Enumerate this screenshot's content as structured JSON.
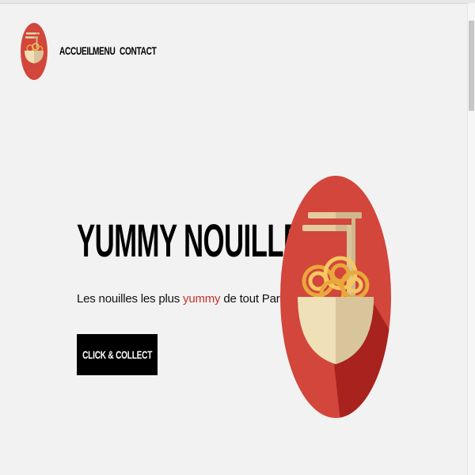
{
  "nav": {
    "items": [
      {
        "label": "ACCUEIL"
      },
      {
        "label": "MENU"
      },
      {
        "label": "CONTACT"
      }
    ]
  },
  "hero": {
    "title": "YUMMY NOUILLES",
    "tagline_before": "Les nouilles les plus ",
    "tagline_accent": "yummy",
    "tagline_after": " de tout Paris",
    "cta_label": "CLICK & COLLECT"
  },
  "icons": {
    "logo": "noodle-bowl-logo-icon",
    "illustration": "noodle-bowl-icon"
  },
  "colors": {
    "background": "#f3f2f2",
    "accent_red": "#d2463b",
    "dark_red": "#a8231e",
    "bowl_light": "#efe0b7",
    "bowl_shade": "#d8c59b",
    "noodle_orange": "#e9a83a",
    "noodle_yellow": "#f5c862",
    "chopsticks": "#cfb78e",
    "cta_bg": "#000000",
    "cta_text": "#ffffff"
  }
}
